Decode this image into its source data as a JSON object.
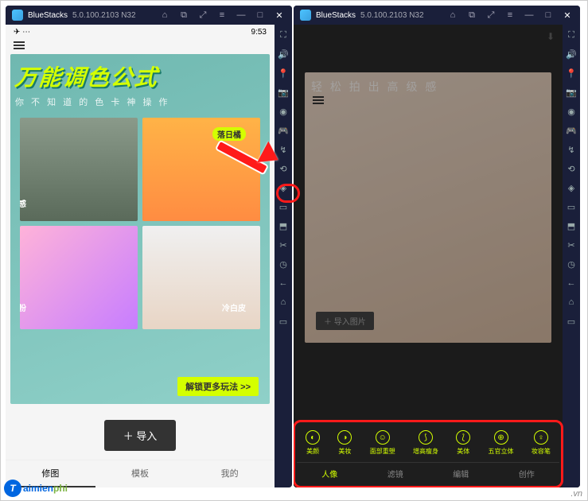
{
  "app": {
    "name": "BlueStacks",
    "version": "5.0.100.2103  N32"
  },
  "titlebar_icons": [
    {
      "name": "home-icon",
      "glyph": "⌂"
    },
    {
      "name": "copy-icon",
      "glyph": "⧉"
    },
    {
      "name": "expand-icon",
      "glyph": "⤢"
    },
    {
      "name": "menu-icon",
      "glyph": "≡"
    },
    {
      "name": "minimize-icon",
      "glyph": "—"
    },
    {
      "name": "maximize-icon",
      "glyph": "□"
    },
    {
      "name": "close-icon",
      "glyph": "✕"
    }
  ],
  "sidebar_icons": [
    {
      "name": "fullscreen-icon",
      "glyph": "⛶"
    },
    {
      "name": "volume-icon",
      "glyph": "🔊"
    },
    {
      "name": "pin-icon",
      "glyph": "📍"
    },
    {
      "name": "camera-icon",
      "glyph": "📷"
    },
    {
      "name": "record-icon",
      "glyph": "◉"
    },
    {
      "name": "gamepad-icon",
      "glyph": "🎮"
    },
    {
      "name": "shake-icon",
      "glyph": "↯"
    },
    {
      "name": "rotate-icon",
      "glyph": "⟲"
    },
    {
      "name": "location-icon",
      "glyph": "◈"
    },
    {
      "name": "folder-icon",
      "glyph": "▭"
    },
    {
      "name": "apk-icon",
      "glyph": "⬒"
    },
    {
      "name": "screenshot-icon",
      "glyph": "✂"
    },
    {
      "name": "clock-icon",
      "glyph": "◷"
    },
    {
      "name": "back-icon",
      "glyph": "←"
    },
    {
      "name": "home2-icon",
      "glyph": "⌂"
    },
    {
      "name": "recent-icon",
      "glyph": "▭"
    }
  ],
  "left": {
    "status_icons": "✈ ⋯",
    "time": "9:53",
    "promo_title": "万能调色公式",
    "promo_sub": "你 不 知 道 的 色 卡 神 操 作",
    "cells": [
      {
        "label": "电影感"
      },
      {
        "label": "落日橘"
      },
      {
        "label": "樱花粉"
      },
      {
        "label": "冷白皮"
      }
    ],
    "unlock": "解锁更多玩法 >>",
    "import": "＋  导入",
    "tabs": [
      "修图",
      "模板",
      "我的"
    ]
  },
  "right": {
    "portrait_text": "轻 松 拍 出 高 级 感",
    "import": "＋ 导入图片",
    "tools": [
      {
        "icon": "◐",
        "label": "美颜"
      },
      {
        "icon": "◑",
        "label": "美妆"
      },
      {
        "icon": "☺",
        "label": "面部重塑"
      },
      {
        "icon": "⟆",
        "label": "增高瘦身"
      },
      {
        "icon": "⟅",
        "label": "美体"
      },
      {
        "icon": "⊕",
        "label": "五官立体"
      },
      {
        "icon": "♀",
        "label": "妆容笔"
      }
    ],
    "cats": [
      "人像",
      "滤镜",
      "编辑",
      "创作"
    ]
  },
  "watermark": {
    "badge": "T",
    "text_blue": "aimien",
    "text_green": "phi"
  },
  "vn": ".vn"
}
